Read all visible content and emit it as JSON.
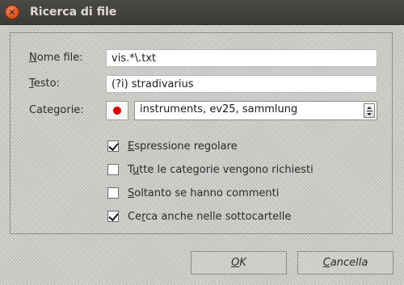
{
  "window": {
    "title": "Ricerca di file",
    "close_glyph": "✕"
  },
  "form": {
    "filename_label_accel": "N",
    "filename_label_rest": "ome file:",
    "filename_value": "vis.*\\.txt",
    "text_label_accel": "T",
    "text_label_rest": "esto:",
    "text_value": "(?i) stradivarius",
    "categories_label": "Categorie:",
    "categories_color": "#e30000",
    "categories_value": "instruments, ev25, sammlung"
  },
  "options": [
    {
      "accel": "E",
      "rest": "spressione regolare",
      "checked": true
    },
    {
      "accel": "u",
      "rest": "tte le categorie vengono richiesti",
      "prefix": "T",
      "checked": false
    },
    {
      "accel": "S",
      "rest": "oltanto se hanno commenti",
      "checked": false
    },
    {
      "accel": "r",
      "rest": "ca anche nelle sottocartelle",
      "prefix": "Ce",
      "checked": true
    }
  ],
  "buttons": {
    "ok_accel": "O",
    "ok_rest": "K",
    "cancel_accel": "C",
    "cancel_rest": "ancella"
  },
  "icons": {
    "close": "close-icon",
    "color": "color-swatch-icon",
    "combo": "combo-arrow-icon",
    "check": "checkmark-icon"
  }
}
